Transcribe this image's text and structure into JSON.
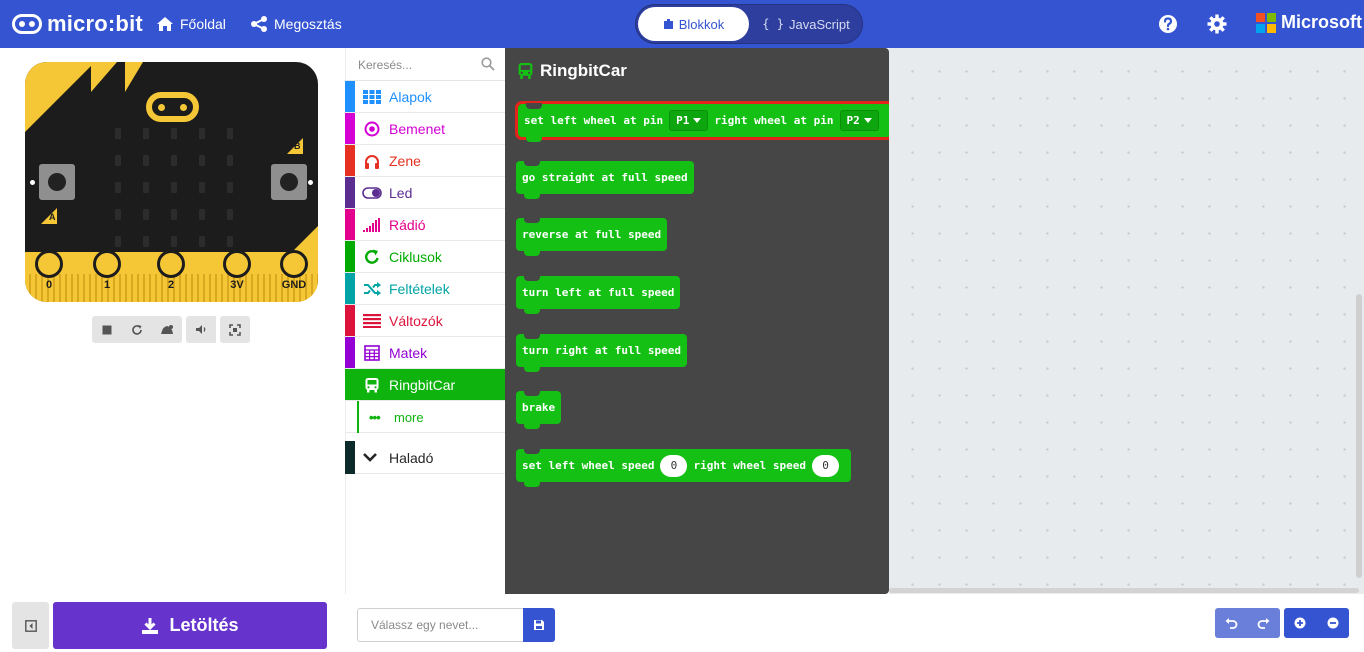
{
  "header": {
    "logo_text": "micro:bit",
    "home_label": "Főoldal",
    "share_label": "Megosztás",
    "editor_toggle": {
      "blocks_label": "Blokkok",
      "javascript_label": "JavaScript",
      "active": "blocks"
    },
    "help_icon": "question-circle-icon",
    "settings_icon": "gear-icon",
    "brand_text": "Microsoft",
    "colors": {
      "bar": "#3454d1"
    }
  },
  "simulator": {
    "pin_labels": [
      "0",
      "1",
      "2",
      "3V",
      "GND"
    ],
    "button_a_label": "A",
    "button_b_label": "B",
    "toolbar_icons": [
      "stop-icon",
      "restart-icon",
      "slow-motion-icon",
      "audio-icon",
      "fullscreen-icon"
    ]
  },
  "toolbox": {
    "search_placeholder": "Keresés...",
    "categories": [
      {
        "label": "Alapok",
        "color": "#1e90ff",
        "icon": "grid-icon"
      },
      {
        "label": "Bemenet",
        "color": "#d400d4",
        "icon": "target-icon"
      },
      {
        "label": "Zene",
        "color": "#e63022",
        "icon": "headphones-icon"
      },
      {
        "label": "Led",
        "color": "#5c2d91",
        "icon": "toggle-icon"
      },
      {
        "label": "Rádió",
        "color": "#e3008c",
        "icon": "signal-icon"
      },
      {
        "label": "Ciklusok",
        "color": "#00aa00",
        "icon": "refresh-icon"
      },
      {
        "label": "Feltételek",
        "color": "#00a4a6",
        "icon": "shuffle-icon"
      },
      {
        "label": "Változók",
        "color": "#dc143c",
        "icon": "lines-icon"
      },
      {
        "label": "Matek",
        "color": "#9400d3",
        "icon": "calculator-icon"
      },
      {
        "label": "RingbitCar",
        "color": "#0eb30e",
        "icon": "bus-icon",
        "selected": true
      }
    ],
    "more_label": "more",
    "advanced_label": "Haladó"
  },
  "flyout": {
    "title": "RingbitCar",
    "blocks": [
      {
        "parts": [
          "set left wheel at pin",
          "P1",
          "right wheel at pin",
          "P2"
        ]
      },
      {
        "text": "go straight at full speed"
      },
      {
        "text": "reverse at full speed"
      },
      {
        "text": "turn left at full speed"
      },
      {
        "text": "turn right at full speed"
      },
      {
        "text": "brake"
      },
      {
        "parts": [
          "set left wheel speed",
          "0",
          "right wheel speed",
          "0"
        ]
      }
    ],
    "colors": {
      "block": "#14c014",
      "selected_outline": "#e4231b",
      "background": "#464646"
    }
  },
  "footer": {
    "download_label": "Letöltés",
    "name_placeholder": "Válassz egy nevet...",
    "colors": {
      "download": "#6633cc"
    }
  }
}
